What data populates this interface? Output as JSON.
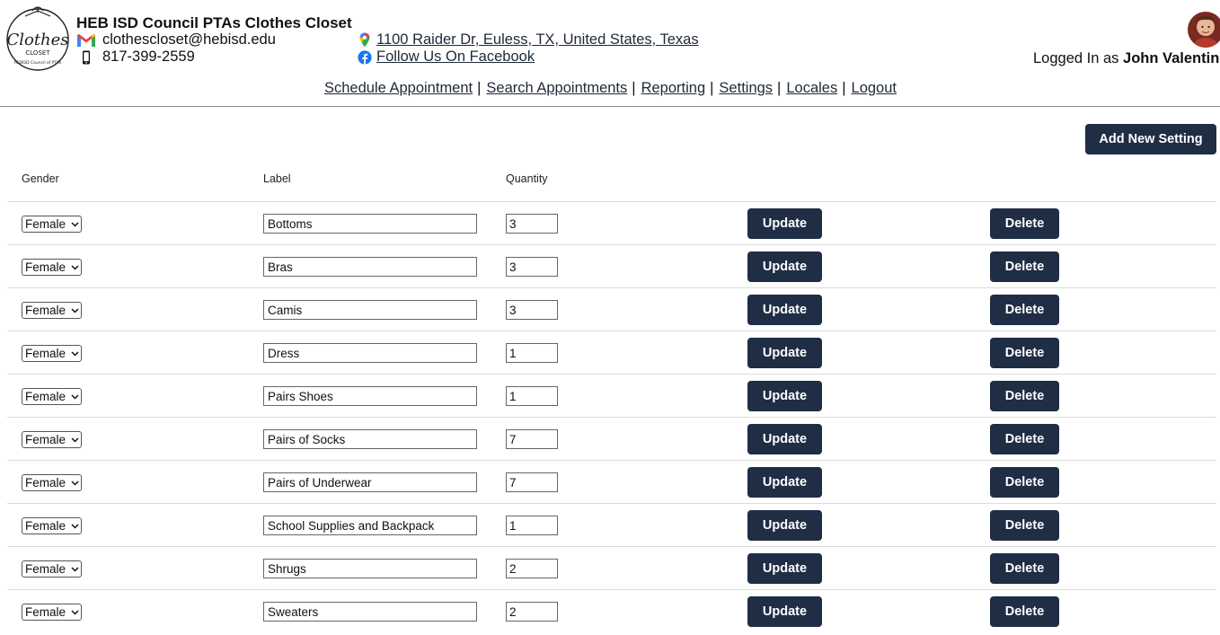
{
  "header": {
    "org_name": "HEB ISD Council PTAs Clothes Closet",
    "email": "clothescloset@hebisd.edu",
    "phone": "817-399-2559",
    "address": "1100 Raider Dr, Euless, TX, United States, Texas",
    "facebook": "Follow Us On Facebook",
    "logged_in_prefix": "Logged In as",
    "user_name": "John Valentino",
    "logo_text": "Clothes Closet HEBISD Council of PTAs"
  },
  "nav": {
    "items": [
      "Schedule Appointment",
      "Search Appointments",
      "Reporting",
      "Settings",
      "Locales",
      "Logout"
    ],
    "separator": "|"
  },
  "actions": {
    "add_label": "Add New Setting"
  },
  "table": {
    "headers": {
      "gender": "Gender",
      "label": "Label",
      "quantity": "Quantity"
    },
    "rows": [
      {
        "gender": "Female",
        "label": "Bottoms",
        "quantity": "3"
      },
      {
        "gender": "Female",
        "label": "Bras",
        "quantity": "3"
      },
      {
        "gender": "Female",
        "label": "Camis",
        "quantity": "3"
      },
      {
        "gender": "Female",
        "label": "Dress",
        "quantity": "1"
      },
      {
        "gender": "Female",
        "label": "Pairs Shoes",
        "quantity": "1"
      },
      {
        "gender": "Female",
        "label": "Pairs of Socks",
        "quantity": "7"
      },
      {
        "gender": "Female",
        "label": "Pairs of Underwear",
        "quantity": "7"
      },
      {
        "gender": "Female",
        "label": "School Supplies and Backpack",
        "quantity": "1"
      },
      {
        "gender": "Female",
        "label": "Shrugs",
        "quantity": "2"
      },
      {
        "gender": "Female",
        "label": "Sweaters",
        "quantity": "2"
      }
    ],
    "update_label": "Update",
    "delete_label": "Delete"
  },
  "icons": {
    "email": "gmail-icon",
    "phone": "mobile-phone-icon",
    "address": "map-pin-icon",
    "facebook": "facebook-icon",
    "select": "chevron-down-icon"
  },
  "colors": {
    "button_bg": "#1f2d45",
    "button_text": "#ffffff",
    "link": "#1f2937",
    "header_border": "#8c8c8c"
  }
}
